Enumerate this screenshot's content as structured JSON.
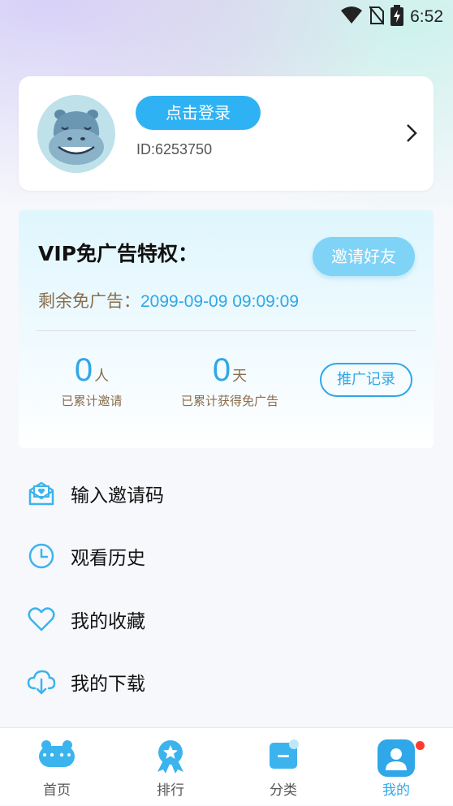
{
  "status": {
    "time": "6:52",
    "icons": [
      "wifi-icon",
      "no-sim-icon",
      "battery-charging-icon"
    ]
  },
  "profile": {
    "login_label": "点击登录",
    "user_id": "ID:6253750",
    "avatar_icon": "hippo-avatar"
  },
  "vip": {
    "title": "VIP免广告特权：",
    "invite_button": "邀请好友",
    "remaining_label": "剩余免广告：",
    "remaining_value": "2099-09-09 09:09:09",
    "stats": [
      {
        "number": "0",
        "unit": "人",
        "label": "已累计邀请"
      },
      {
        "number": "0",
        "unit": "天",
        "label": "已累计获得免广告"
      }
    ],
    "promo_button": "推广记录"
  },
  "menu": [
    {
      "label": "输入邀请码",
      "icon": "envelope-heart-icon"
    },
    {
      "label": "观看历史",
      "icon": "clock-icon"
    },
    {
      "label": "我的收藏",
      "icon": "heart-icon"
    },
    {
      "label": "我的下载",
      "icon": "cloud-download-icon"
    }
  ],
  "nav": [
    {
      "label": "首页",
      "icon": "home-icon",
      "active": false
    },
    {
      "label": "排行",
      "icon": "ranking-icon",
      "active": false
    },
    {
      "label": "分类",
      "icon": "category-icon",
      "active": false
    },
    {
      "label": "我的",
      "icon": "profile-icon",
      "active": true
    }
  ],
  "colors": {
    "accent": "#2fa7e8",
    "button": "#2fb2f3",
    "brown_text": "#8a6d4e",
    "badge": "#ff3b30"
  }
}
